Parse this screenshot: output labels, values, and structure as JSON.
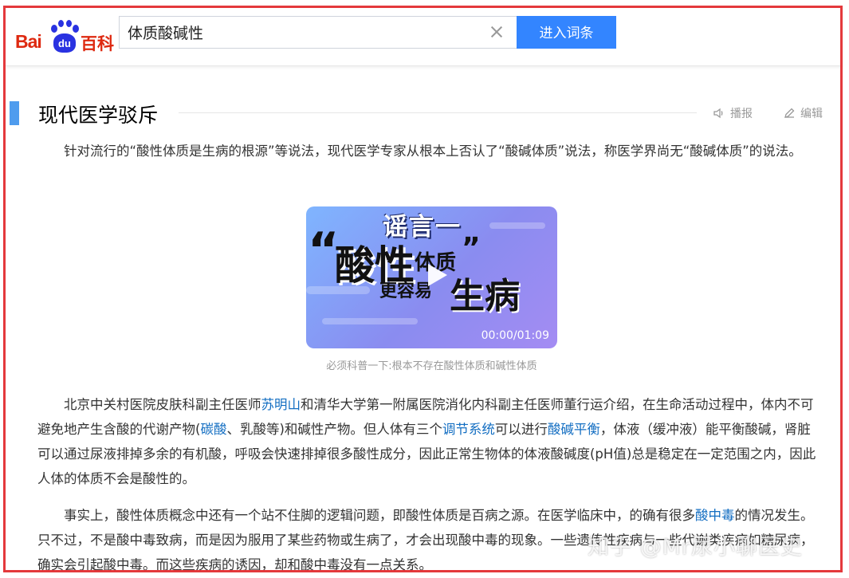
{
  "header": {
    "logo": {
      "bai": "Bai",
      "du": "du",
      "baike": "百科"
    },
    "search": {
      "value": "体质酸碱性"
    },
    "enter_button": "进入词条"
  },
  "section": {
    "title": "现代医学驳斥",
    "actions": {
      "listen": "播报",
      "edit": "编辑"
    }
  },
  "article": {
    "intro": "针对流行的“酸性体质是生病的根源”等说法，现代医学专家从根本上否认了“酸碱体质”说法，称医学界尚无“酸碱体质”的说法。",
    "video": {
      "overlay_line1": "谣言一",
      "overlay_open_quote": "“",
      "overlay_main": "酸性",
      "overlay_small": "体质",
      "overlay_close_quote": "”",
      "overlay_line3a": "更容易",
      "overlay_line3b": "生病",
      "duration": "00:00/01:09",
      "caption": "必须科普一下:根本不存在酸性体质和碱性体质"
    },
    "p2": {
      "t1": "北京中关村医院皮肤科副主任医师",
      "link1": "苏明山",
      "t2": "和清华大学第一附属医院消化内科副主任医师董行运介绍，在生命活动过程中，体内不可避免地产生含酸的代谢产物(",
      "link2": "碳酸",
      "t3": "、乳酸等)和碱性产物。但人体有三个",
      "link3": "调节系统",
      "t4": "可以进行",
      "link4": "酸碱平衡",
      "t5": "，体液（缓冲液）能平衡酸碱，肾脏可以通过尿液排掉多余的有机酸，呼吸会快速排掉很多酸性成分，因此正常生物体的体液酸碱度(pH值)总是稳定在一定范围之内，因此人体的体质不会是酸性的。"
    },
    "p3": {
      "t1": "事实上，酸性体质概念中还有一个站不住脚的逻辑问题，即酸性体质是百病之源。在医学临床中，的确有很多",
      "link1": "酸中毒",
      "t2": "的情况发生。只不过，不是酸中毒致病，而是因为服用了某些药物或生病了，才会出现酸中毒的现象。一些遗传性疾病与一些代谢类疾病如糖尿病，确实会引起酸中毒。而这些疾病的诱因，却和酸中毒没有一点关系。"
    }
  },
  "watermark": "知乎 @Mr尿小聊医史",
  "colors": {
    "brand_red": "#de2910",
    "brand_blue": "#2932e1",
    "button_blue": "#3385ff",
    "link": "#136ec2",
    "frame": "#e4393c"
  }
}
